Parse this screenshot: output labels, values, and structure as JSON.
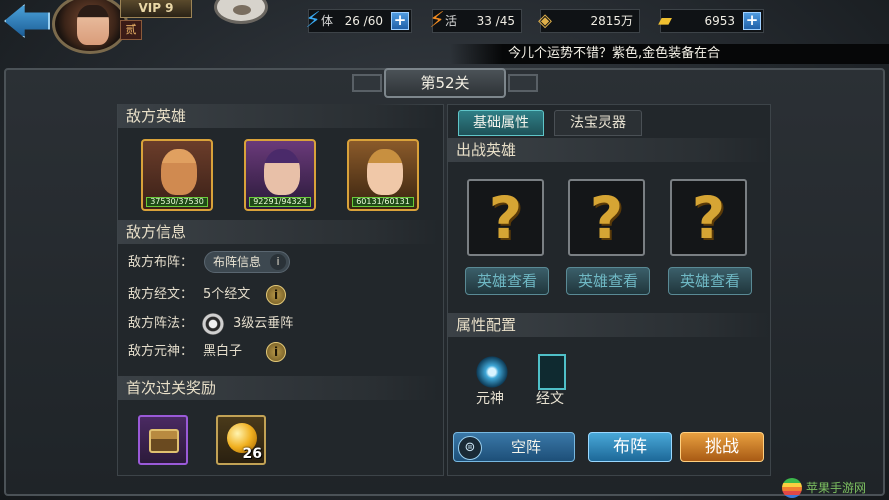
{
  "top": {
    "vip": "VIP 9",
    "rank": "贰",
    "stamina_label": "体",
    "stamina": "26 /60",
    "vitality_label": "活",
    "vitality": "33 /45",
    "coins": "2815万",
    "ingots": "6953",
    "marquee": "今儿个运势不错？紫色,金色装备在合"
  },
  "stage": {
    "title": "第52关"
  },
  "left": {
    "enemy_heroes_title": "敌方英雄",
    "heroes": [
      {
        "hp": "37530/37530"
      },
      {
        "hp": "92291/94324"
      },
      {
        "hp": "60131/60131"
      }
    ],
    "enemy_info_title": "敌方信息",
    "formation_label": "敌方布阵：",
    "formation_pill": "布阵信息",
    "scripture_label": "敌方经文：",
    "scripture_value": "5个经文",
    "array_label": "敌方阵法：",
    "array_value": "3级云垂阵",
    "spirit_label": "敌方元神：",
    "spirit_value": "黑白子",
    "reward_title": "首次过关奖励",
    "reward_count": "26"
  },
  "right": {
    "tabs": [
      "基础属性",
      "法宝灵器"
    ],
    "battle_heroes_title": "出战英雄",
    "unknown_mark": "?",
    "view_hero": "英雄查看",
    "attr_config_title": "属性配置",
    "attr_yuan": "元神",
    "attr_jing": "经文"
  },
  "buttons": {
    "empty": "空阵",
    "arrange": "布阵",
    "challenge": "挑战"
  },
  "icons": {
    "info": "i",
    "plus": "+"
  },
  "watermark": "苹果手游网"
}
